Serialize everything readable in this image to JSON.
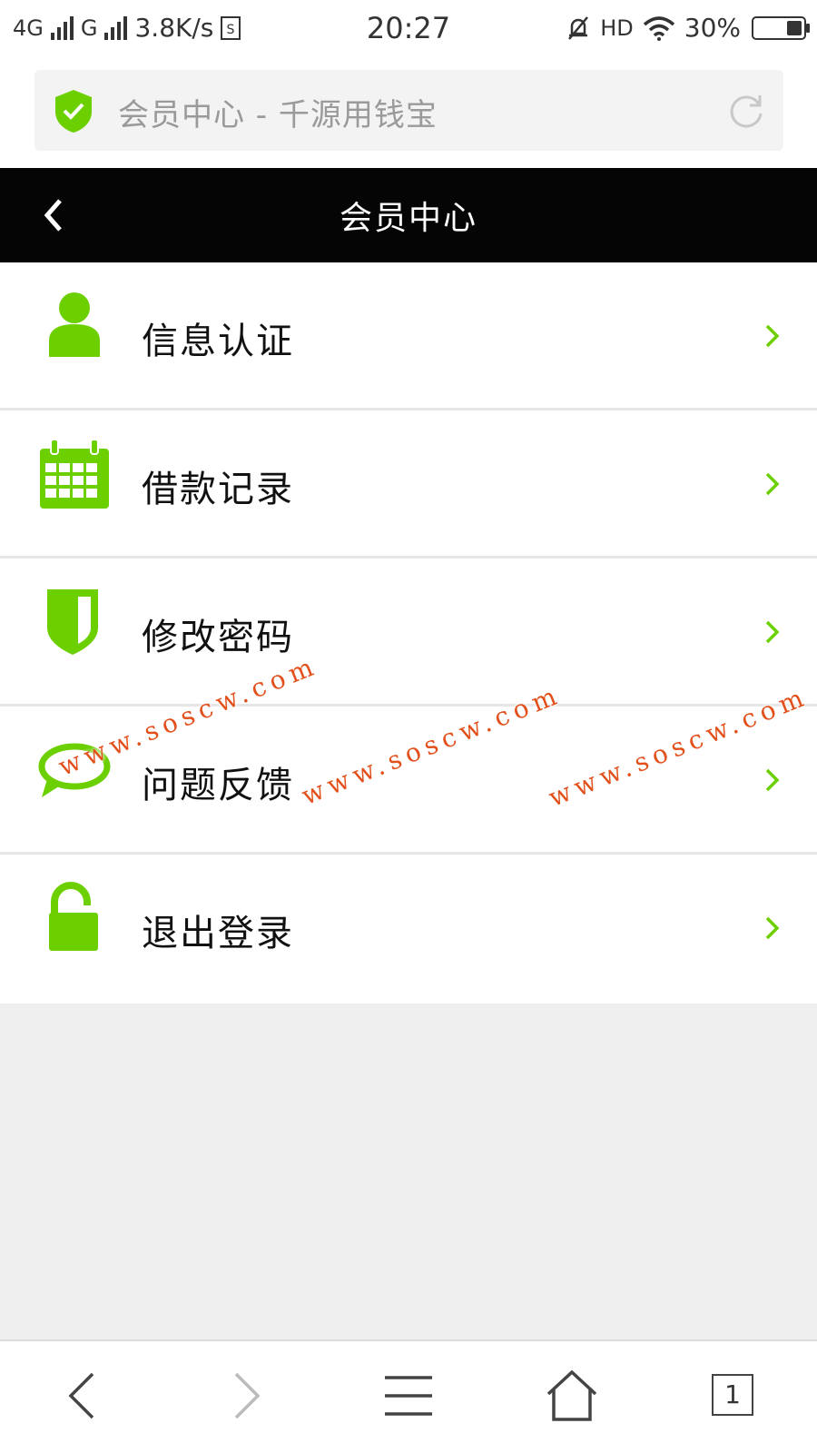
{
  "status_bar": {
    "network1": "4G",
    "network2": "G",
    "speed": "3.8K/s",
    "time": "20:27",
    "hd": "HD",
    "battery": "30%"
  },
  "address_bar": {
    "page_title": "会员中心 - 千源用钱宝"
  },
  "header": {
    "title": "会员中心"
  },
  "menu": {
    "items": [
      {
        "label": "信息认证",
        "icon": "user-icon"
      },
      {
        "label": "借款记录",
        "icon": "calendar-icon"
      },
      {
        "label": "修改密码",
        "icon": "shield-icon"
      },
      {
        "label": "问题反馈",
        "icon": "chat-bubble-icon"
      },
      {
        "label": "退出登录",
        "icon": "unlock-icon"
      }
    ]
  },
  "watermark": {
    "text": "www.soscw.com"
  },
  "bottom_bar": {
    "tab_count": "1"
  },
  "colors": {
    "accent_green": "#6ccf00",
    "header_bg": "#050505",
    "watermark": "#e2501c"
  }
}
